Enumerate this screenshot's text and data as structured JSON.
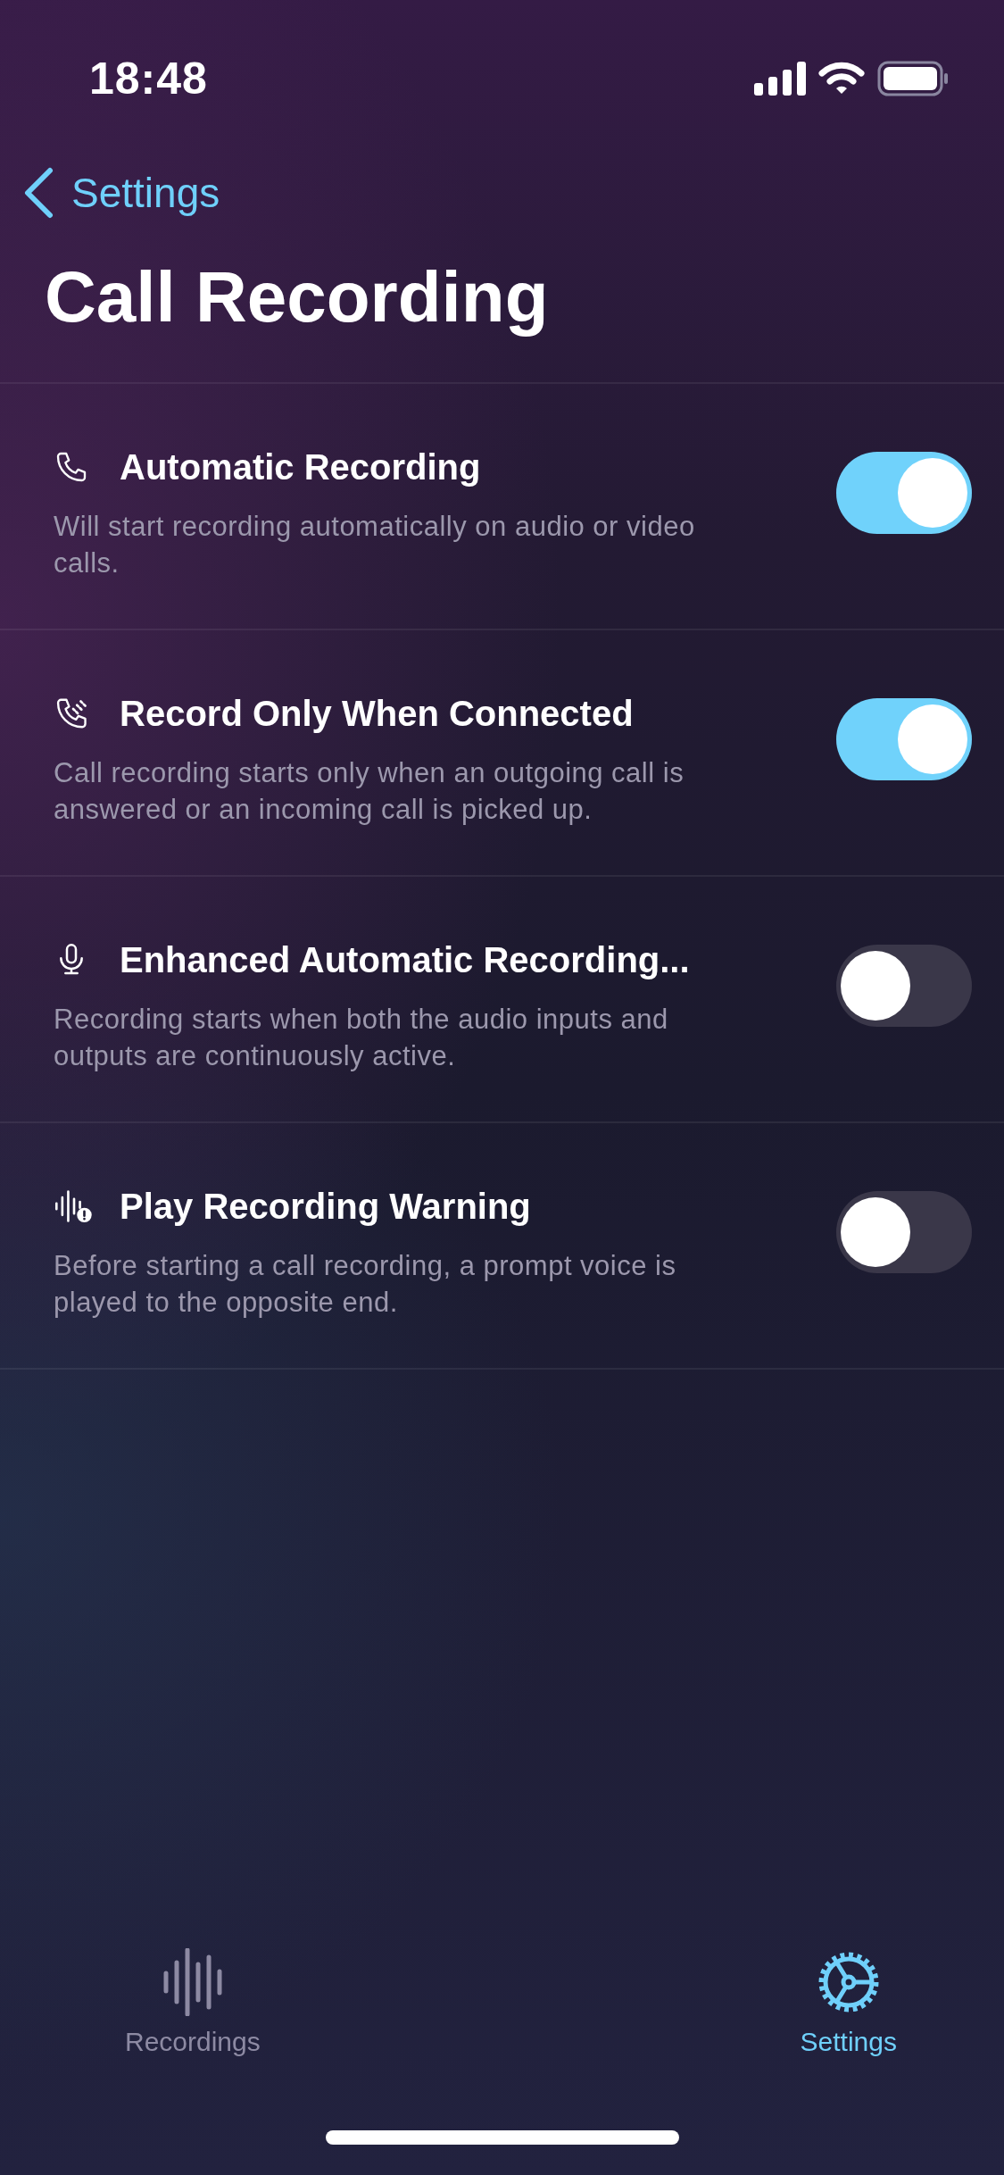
{
  "status_bar": {
    "time": "18:48"
  },
  "nav": {
    "back_label": "Settings",
    "title": "Call Recording"
  },
  "settings": [
    {
      "title": "Automatic Recording",
      "description": "Will start recording automatically on audio or video calls.",
      "on": true
    },
    {
      "title": "Record Only When Connected",
      "description": "Call recording starts only when an outgoing call is answered or an incoming call is picked up.",
      "on": true
    },
    {
      "title": "Enhanced Automatic Recording...",
      "description": "Recording starts when both the audio inputs and outputs are continuously active.",
      "on": false
    },
    {
      "title": "Play Recording Warning",
      "description": "Before starting a call recording, a prompt voice is played to the opposite end.",
      "on": false
    }
  ],
  "tab_bar": [
    {
      "label": "Recordings",
      "selected": false
    },
    {
      "label": "Settings",
      "selected": true
    }
  ]
}
